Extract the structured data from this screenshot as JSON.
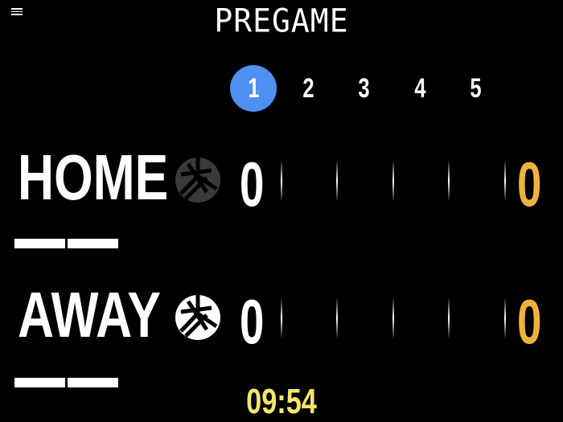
{
  "header": {
    "menu_icon": "hamburger-menu-icon",
    "status": "PREGAME"
  },
  "sets": [
    {
      "label": "1",
      "active": true
    },
    {
      "label": "2",
      "active": false
    },
    {
      "label": "3",
      "active": false
    },
    {
      "label": "4",
      "active": false
    },
    {
      "label": "5",
      "active": false
    }
  ],
  "teams": {
    "home": {
      "name": "HOME",
      "serve_icon": "volleyball-icon",
      "serving": false,
      "set_score": "0",
      "match_score": "0",
      "timeouts_remaining": 2
    },
    "away": {
      "name": "AWAY",
      "serve_icon": "volleyball-icon",
      "serving": true,
      "set_score": "0",
      "match_score": "0",
      "timeouts_remaining": 2
    }
  },
  "clock": "09:54",
  "colors": {
    "active_set": "#4f8ff0",
    "match_score": "#efb23c",
    "clock": "#f5e56a",
    "ball_inactive": "#3a3a3a",
    "ball_active": "#ffffff"
  }
}
